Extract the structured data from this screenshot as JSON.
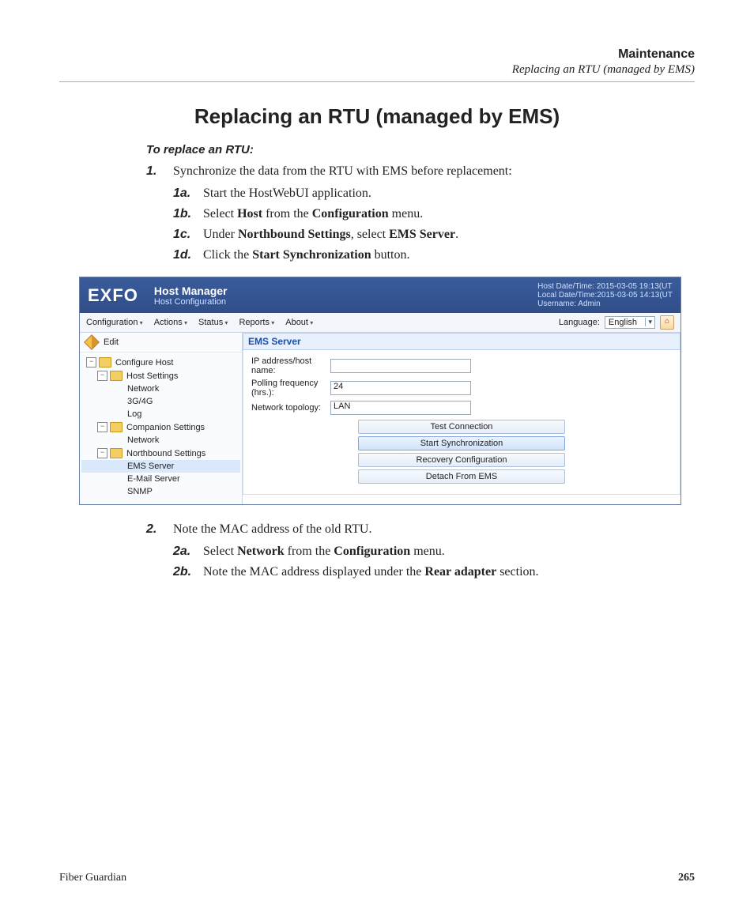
{
  "running_head": {
    "chapter": "Maintenance",
    "section": "Replacing an RTU (managed by EMS)"
  },
  "title": "Replacing an RTU (managed by EMS)",
  "lead": "To replace an RTU:",
  "steps": {
    "s1": {
      "num": "1.",
      "text_a": "Synchronize the data from the RTU with EMS before replacement:"
    },
    "s1a": {
      "num": "1a.",
      "text": "Start the HostWebUI application."
    },
    "s1b": {
      "num": "1b.",
      "pre": "Select ",
      "b1": "Host",
      "mid": " from the ",
      "b2": "Configuration",
      "post": " menu."
    },
    "s1c": {
      "num": "1c.",
      "pre": "Under ",
      "b1": "Northbound Settings",
      "mid": ", select ",
      "b2": "EMS Server",
      "post": "."
    },
    "s1d": {
      "num": "1d.",
      "pre": "Click the ",
      "b1": "Start Synchronization",
      "post": " button."
    },
    "s2": {
      "num": "2.",
      "text": "Note the MAC address of the old RTU."
    },
    "s2a": {
      "num": "2a.",
      "pre": "Select ",
      "b1": "Network",
      "mid": " from the ",
      "b2": "Configuration",
      "post": " menu."
    },
    "s2b": {
      "num": "2b.",
      "pre": "Note the MAC address displayed under the ",
      "b1": "Rear adapter",
      "post": " section."
    }
  },
  "shot": {
    "logo": "EXFO",
    "header_title": "Host Manager",
    "header_sub": "Host Configuration",
    "meta1": "Host Date/Time: 2015-03-05 19:13(UT",
    "meta2": "Local Date/Time:2015-03-05 14:13(UT",
    "meta3": "Username: Admin",
    "menu": [
      "Configuration",
      "Actions",
      "Status",
      "Reports",
      "About"
    ],
    "lang_label": "Language:",
    "lang_value": "English",
    "edit": "Edit",
    "tree": {
      "n0": "Configure Host",
      "n1": "Host Settings",
      "n1a": "Network",
      "n1b": "3G/4G",
      "n1c": "Log",
      "n2": "Companion Settings",
      "n2a": "Network",
      "n3": "Northbound Settings",
      "n3a": "EMS Server",
      "n3b": "E-Mail Server",
      "n3c": "SNMP"
    },
    "panel_title": "EMS Server",
    "fields": {
      "ip_lbl": "IP address/host name:",
      "ip_val": "",
      "poll_lbl": "Polling frequency (hrs.):",
      "poll_val": "24",
      "topo_lbl": "Network topology:",
      "topo_val": "LAN"
    },
    "buttons": {
      "test": "Test Connection",
      "sync": "Start Synchronization",
      "recov": "Recovery Configuration",
      "detach": "Detach From EMS"
    }
  },
  "footer": {
    "product": "Fiber Guardian",
    "page": "265"
  }
}
